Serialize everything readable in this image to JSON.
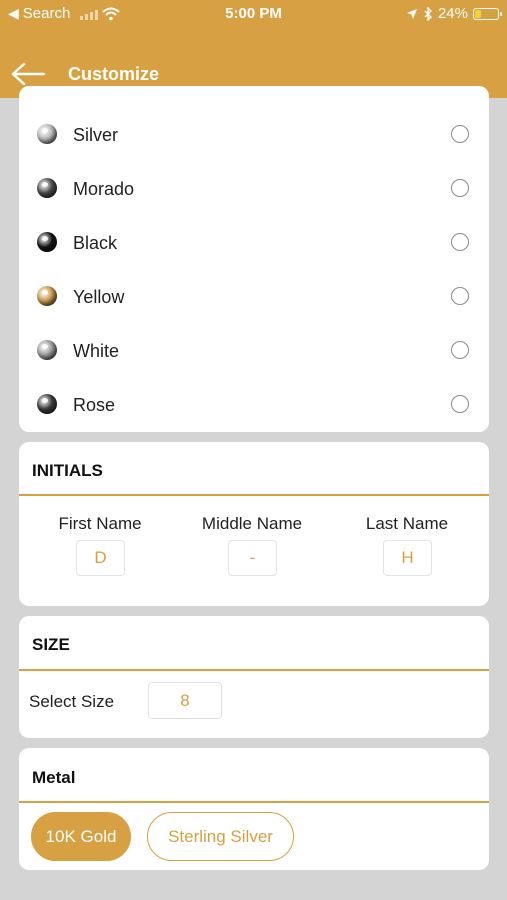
{
  "status_bar": {
    "back_app": "Search",
    "time": "5:00 PM",
    "battery": "24%"
  },
  "nav": {
    "title": "Customize"
  },
  "colors": [
    {
      "label": "Silver",
      "swatch": "#b8b8b8"
    },
    {
      "label": "Morado",
      "swatch": "#4a4a4a"
    },
    {
      "label": "Black",
      "swatch": "#151515"
    },
    {
      "label": "Yellow",
      "swatch": "#c9984a"
    },
    {
      "label": "White",
      "swatch": "#9a9a9a"
    },
    {
      "label": "Rose",
      "swatch": "#3a3a3a"
    }
  ],
  "initials": {
    "title": "INITIALS",
    "first_label": "First Name",
    "first_value": "D",
    "middle_label": "Middle Name",
    "middle_value": "-",
    "last_label": "Last Name",
    "last_value": "H"
  },
  "size": {
    "title": "SIZE",
    "label": "Select Size",
    "value": "8"
  },
  "metal": {
    "title": "Metal",
    "options": [
      "10K Gold",
      "Sterling Silver"
    ],
    "selected": "10K Gold"
  },
  "theme": {
    "accent": "#d7a042",
    "background": "#d4d4d4"
  }
}
